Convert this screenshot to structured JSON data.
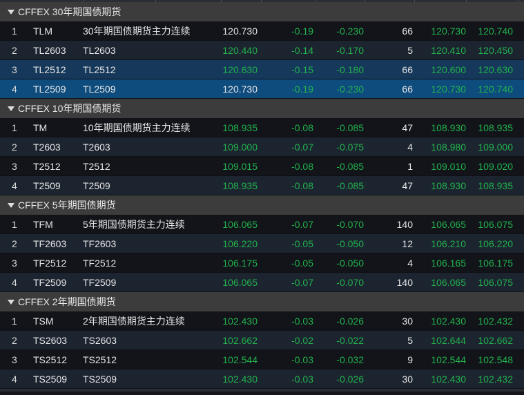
{
  "colors": {
    "green": "#22b24c",
    "white": "#e6e6e6",
    "header_bg": "#3c3c3c",
    "selected_bg": "#0e4c7e"
  },
  "groups": [
    {
      "title": "CFFEX 30年期国债期货",
      "rows": [
        {
          "idx": "1",
          "code": "TLM",
          "name": "30年期国债期货主力连续",
          "last": "120.730",
          "last_color": "flat",
          "chg": "-0.19",
          "pct": "-0.230",
          "vol": "66",
          "bid": "120.730",
          "ask": "120.740",
          "state": "normal"
        },
        {
          "idx": "2",
          "code": "TL2603",
          "name": "TL2603",
          "last": "120.440",
          "last_color": "up",
          "chg": "-0.14",
          "pct": "-0.170",
          "vol": "5",
          "bid": "120.410",
          "ask": "120.450",
          "state": "normal"
        },
        {
          "idx": "3",
          "code": "TL2512",
          "name": "TL2512",
          "last": "120.630",
          "last_color": "up",
          "chg": "-0.15",
          "pct": "-0.180",
          "vol": "66",
          "bid": "120.600",
          "ask": "120.630",
          "state": "hover"
        },
        {
          "idx": "4",
          "code": "TL2509",
          "name": "TL2509",
          "last": "120.730",
          "last_color": "flat",
          "chg": "-0.19",
          "pct": "-0.230",
          "vol": "66",
          "bid": "120.730",
          "ask": "120.740",
          "state": "selected"
        }
      ]
    },
    {
      "title": "CFFEX 10年期国债期货",
      "rows": [
        {
          "idx": "1",
          "code": "TM",
          "name": "10年期国债期货主力连续",
          "last": "108.935",
          "last_color": "up",
          "chg": "-0.08",
          "pct": "-0.085",
          "vol": "47",
          "bid": "108.930",
          "ask": "108.935",
          "state": "normal"
        },
        {
          "idx": "2",
          "code": "T2603",
          "name": "T2603",
          "last": "109.000",
          "last_color": "up",
          "chg": "-0.07",
          "pct": "-0.075",
          "vol": "4",
          "bid": "108.980",
          "ask": "109.000",
          "state": "normal"
        },
        {
          "idx": "3",
          "code": "T2512",
          "name": "T2512",
          "last": "109.015",
          "last_color": "up",
          "chg": "-0.08",
          "pct": "-0.085",
          "vol": "1",
          "bid": "109.010",
          "ask": "109.020",
          "state": "normal"
        },
        {
          "idx": "4",
          "code": "T2509",
          "name": "T2509",
          "last": "108.935",
          "last_color": "up",
          "chg": "-0.08",
          "pct": "-0.085",
          "vol": "47",
          "bid": "108.930",
          "ask": "108.935",
          "state": "normal"
        }
      ]
    },
    {
      "title": "CFFEX 5年期国债期货",
      "rows": [
        {
          "idx": "1",
          "code": "TFM",
          "name": "5年期国债期货主力连续",
          "last": "106.065",
          "last_color": "up",
          "chg": "-0.07",
          "pct": "-0.070",
          "vol": "140",
          "bid": "106.065",
          "ask": "106.075",
          "state": "normal"
        },
        {
          "idx": "2",
          "code": "TF2603",
          "name": "TF2603",
          "last": "106.220",
          "last_color": "up",
          "chg": "-0.05",
          "pct": "-0.050",
          "vol": "12",
          "bid": "106.210",
          "ask": "106.220",
          "state": "normal"
        },
        {
          "idx": "3",
          "code": "TF2512",
          "name": "TF2512",
          "last": "106.175",
          "last_color": "up",
          "chg": "-0.05",
          "pct": "-0.050",
          "vol": "4",
          "bid": "106.165",
          "ask": "106.175",
          "state": "normal"
        },
        {
          "idx": "4",
          "code": "TF2509",
          "name": "TF2509",
          "last": "106.065",
          "last_color": "up",
          "chg": "-0.07",
          "pct": "-0.070",
          "vol": "140",
          "bid": "106.065",
          "ask": "106.075",
          "state": "normal"
        }
      ]
    },
    {
      "title": "CFFEX 2年期国债期货",
      "rows": [
        {
          "idx": "1",
          "code": "TSM",
          "name": "2年期国债期货主力连续",
          "last": "102.430",
          "last_color": "up",
          "chg": "-0.03",
          "pct": "-0.026",
          "vol": "30",
          "bid": "102.430",
          "ask": "102.432",
          "state": "normal"
        },
        {
          "idx": "2",
          "code": "TS2603",
          "name": "TS2603",
          "last": "102.662",
          "last_color": "up",
          "chg": "-0.02",
          "pct": "-0.022",
          "vol": "5",
          "bid": "102.644",
          "ask": "102.662",
          "state": "normal"
        },
        {
          "idx": "3",
          "code": "TS2512",
          "name": "TS2512",
          "last": "102.544",
          "last_color": "up",
          "chg": "-0.03",
          "pct": "-0.032",
          "vol": "9",
          "bid": "102.544",
          "ask": "102.548",
          "state": "normal"
        },
        {
          "idx": "4",
          "code": "TS2509",
          "name": "TS2509",
          "last": "102.430",
          "last_color": "up",
          "chg": "-0.03",
          "pct": "-0.026",
          "vol": "30",
          "bid": "102.430",
          "ask": "102.432",
          "state": "normal"
        }
      ]
    }
  ]
}
